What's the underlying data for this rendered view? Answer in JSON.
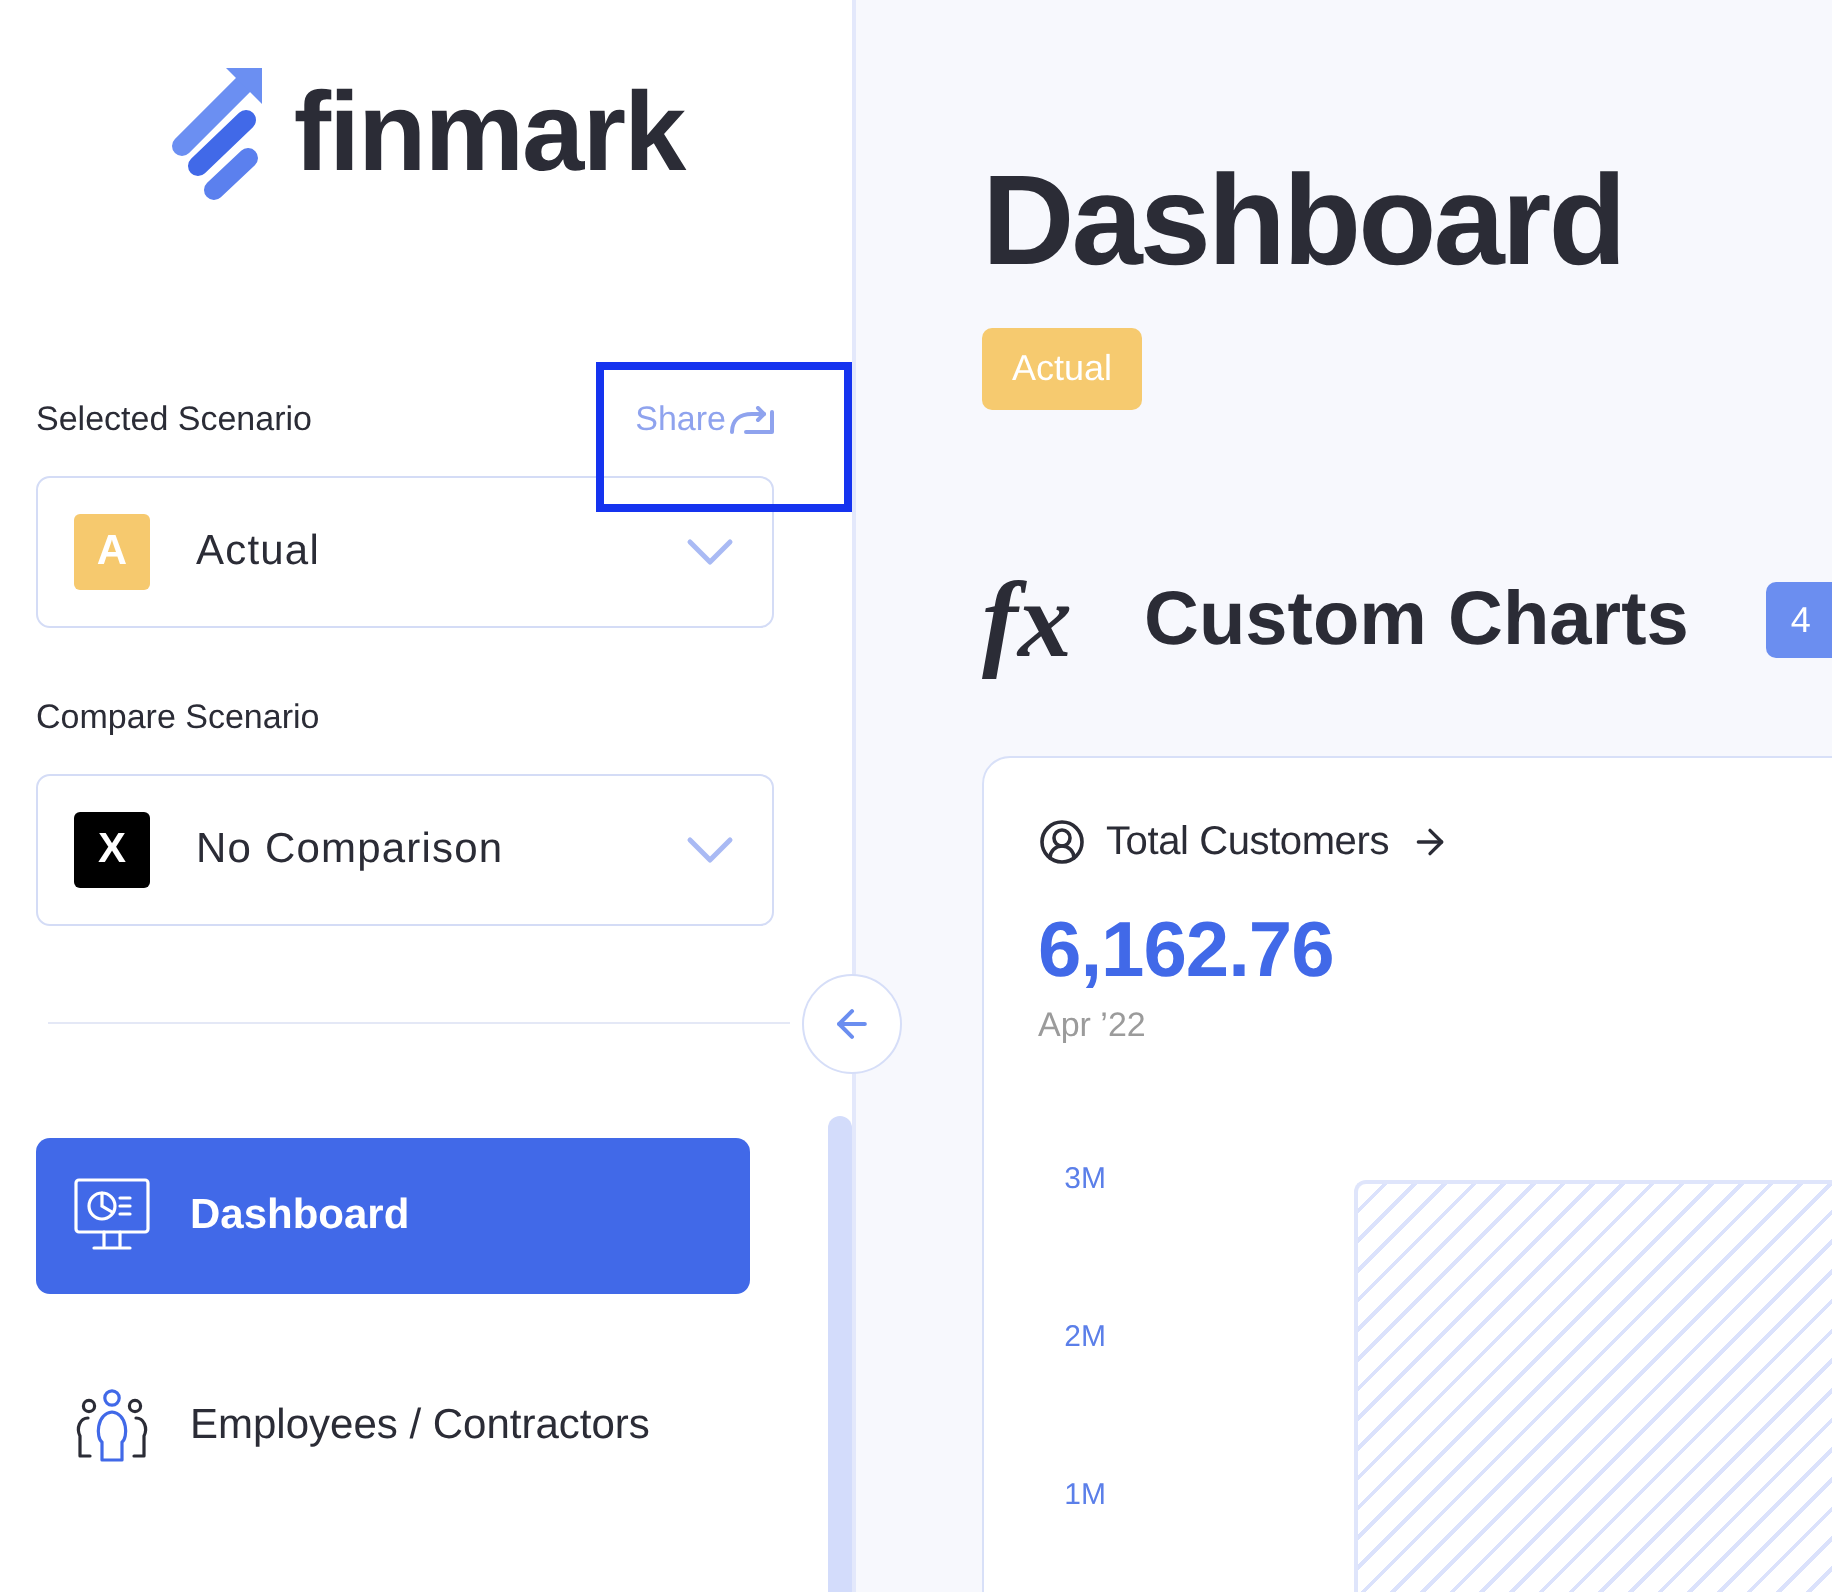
{
  "logo": {
    "text": "finmark"
  },
  "sidebar": {
    "scenario_pickers": [
      {
        "label": "Selected Scenario",
        "share": {
          "label": "Share",
          "highlighted": true
        },
        "badge": "A",
        "color": "#f6c96e",
        "value": "Actual"
      },
      {
        "label": "Compare Scenario",
        "badge": "X",
        "color": "#000000",
        "value": "No Comparison"
      }
    ],
    "nav": [
      {
        "kind": "dashboard",
        "label": "Dashboard",
        "selected": true
      },
      {
        "kind": "people",
        "label": "Employees / Contractors",
        "selected": false
      }
    ]
  },
  "main": {
    "title": "Dashboard",
    "scenario_badge": "Actual",
    "section": {
      "icon": "fx",
      "title": "Custom Charts",
      "count_badge": "4"
    },
    "card": {
      "title": "Total Customers",
      "value": "6,162.76",
      "period": "Apr ’22",
      "y_labels": [
        "3M",
        "2M",
        "1M"
      ]
    }
  }
}
